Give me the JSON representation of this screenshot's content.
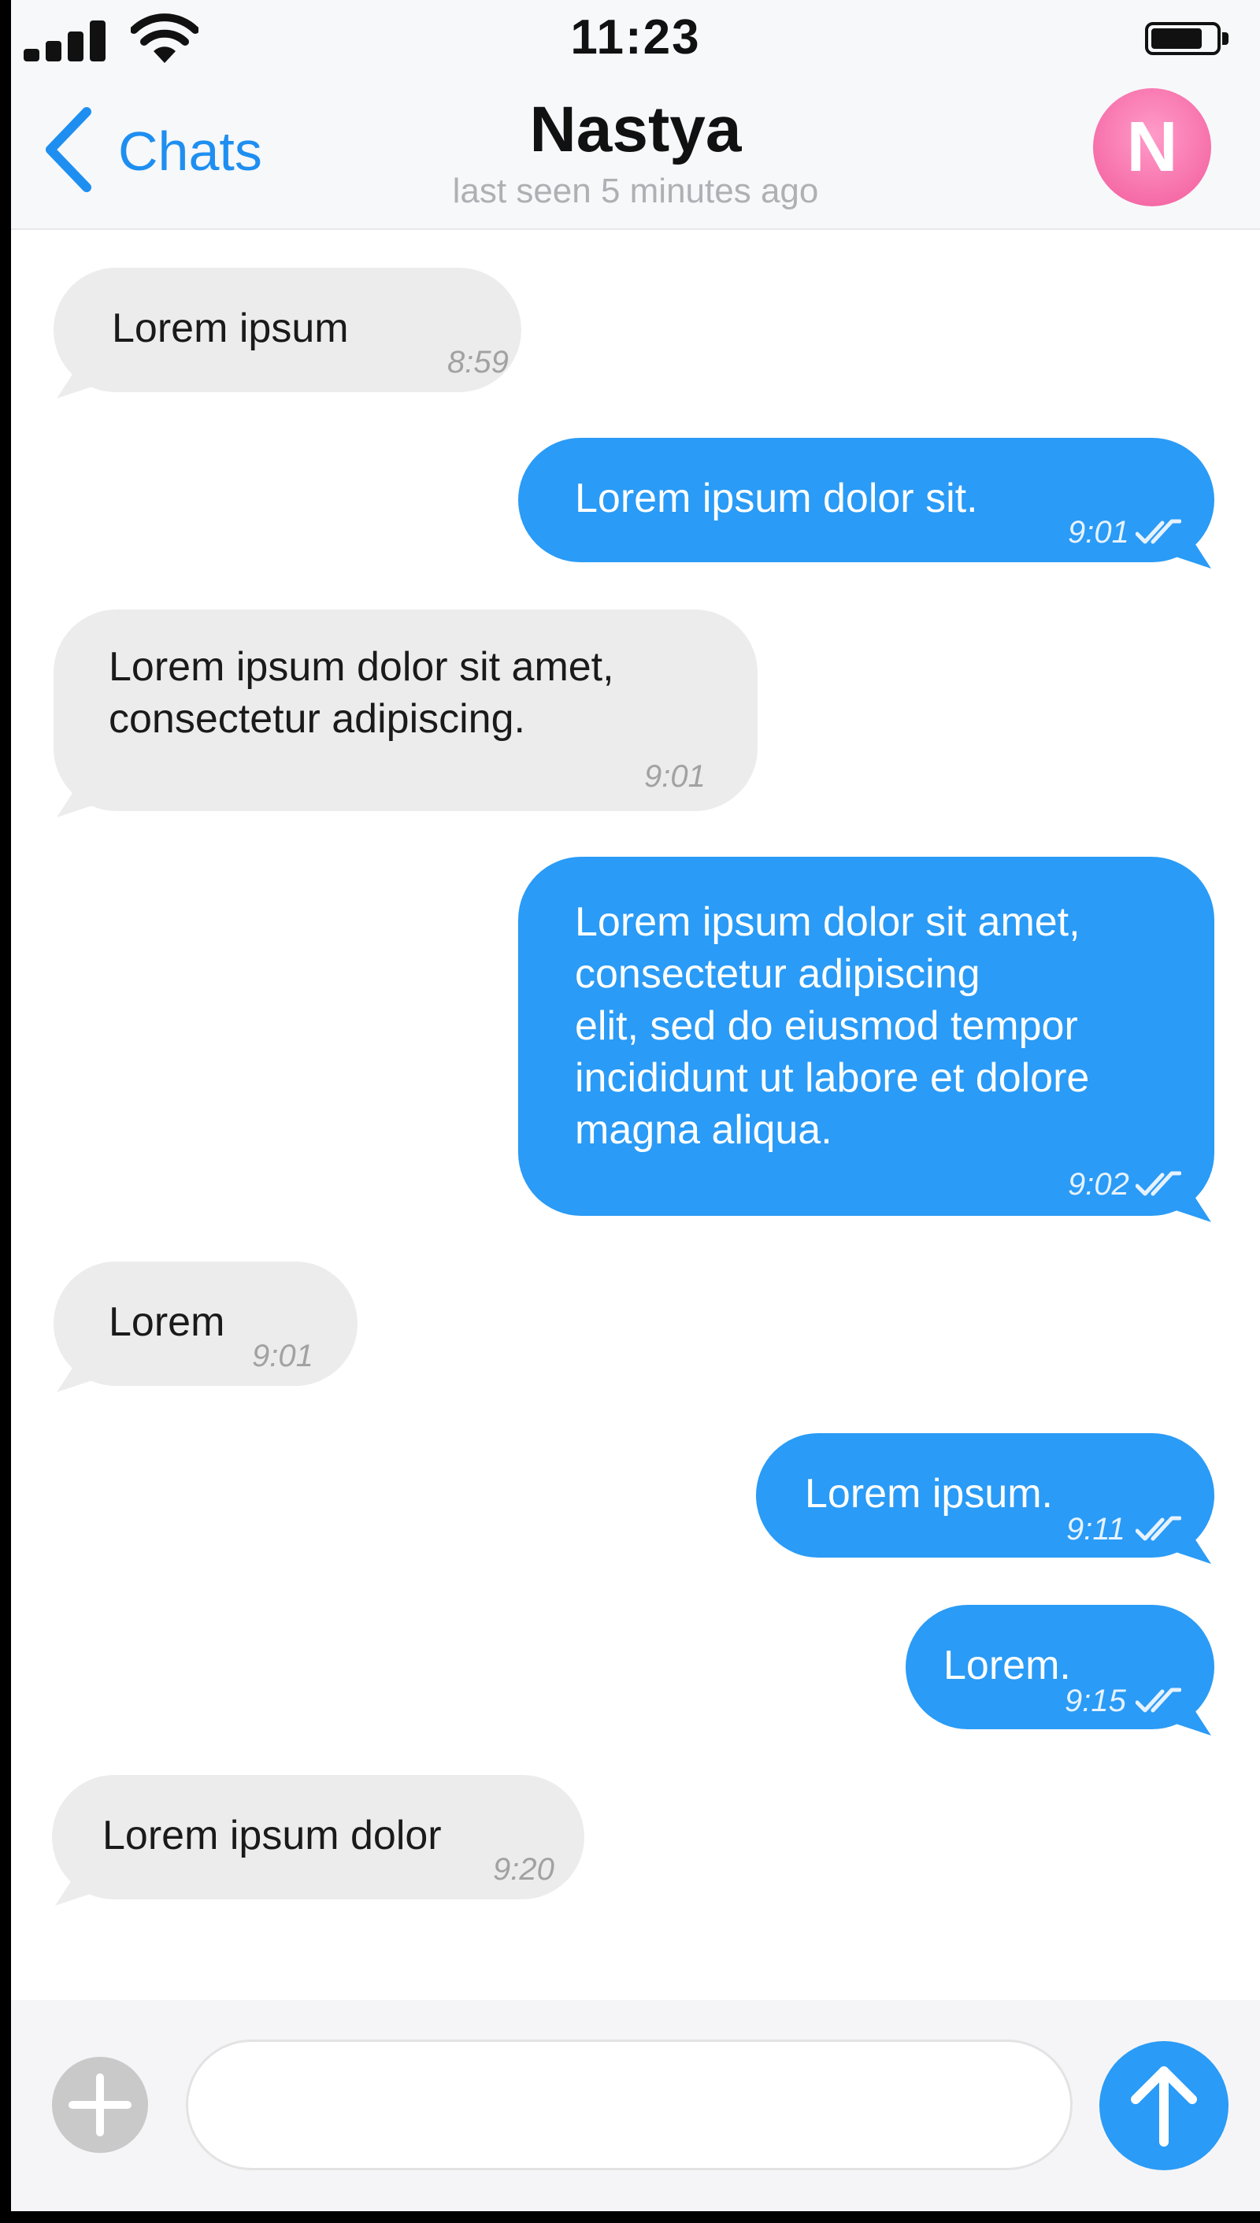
{
  "status_bar": {
    "time": "11:23",
    "signal_bars": 4,
    "battery_level": 0.8
  },
  "header": {
    "back_label": "Chats",
    "contact_name": "Nastya",
    "status_text": "last seen 5 minutes ago",
    "avatar_initial": "N"
  },
  "messages": [
    {
      "direction": "incoming",
      "text": "Lorem ipsum",
      "time": "8:59"
    },
    {
      "direction": "outgoing",
      "text": "Lorem ipsum dolor sit.",
      "time": "9:01",
      "read": true
    },
    {
      "direction": "incoming",
      "text": "Lorem ipsum dolor sit amet,\nconsectetur adipiscing.",
      "time": "9:01"
    },
    {
      "direction": "outgoing",
      "text": "Lorem ipsum dolor sit amet,\nconsectetur adipiscing\nelit, sed do eiusmod tempor\nincididunt ut labore et dolore\nmagna aliqua.",
      "time": "9:02",
      "read": true
    },
    {
      "direction": "incoming",
      "text": "Lorem",
      "time": "9:01"
    },
    {
      "direction": "outgoing",
      "text": "Lorem ipsum.",
      "time": "9:11",
      "read": true
    },
    {
      "direction": "outgoing",
      "text": "Lorem.",
      "time": "9:15",
      "read": true
    },
    {
      "direction": "incoming",
      "text": "Lorem ipsum dolor",
      "time": "9:20"
    }
  ],
  "composer": {
    "value": "",
    "placeholder": ""
  },
  "icons": {
    "back": "chevron-left-icon",
    "attach": "plus-icon",
    "send": "arrow-up-icon",
    "read_receipt": "double-check-icon"
  },
  "colors": {
    "accent": "#2a9bf6",
    "incoming_bubble": "#ececec",
    "avatar": "#f25a9b",
    "link": "#1e8ff0"
  }
}
